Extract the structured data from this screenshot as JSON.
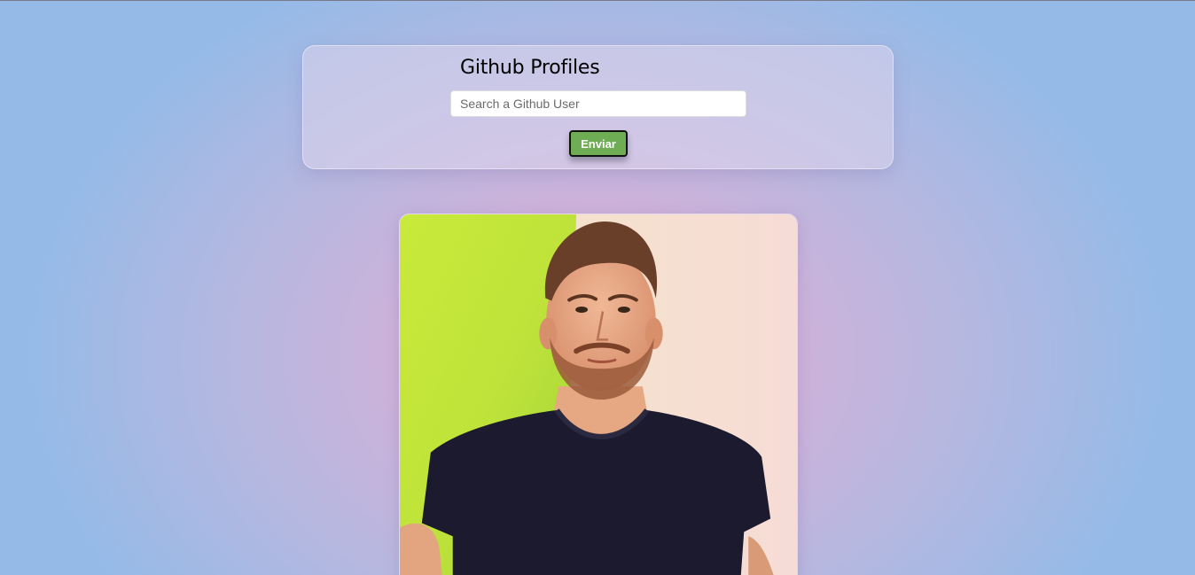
{
  "header": {
    "title": "Github Profiles"
  },
  "search": {
    "placeholder": "Search a Github User",
    "value": "",
    "submit_label": "Enviar"
  },
  "profile": {
    "avatar_alt": ""
  },
  "colors": {
    "button_bg": "#6fad55",
    "background_center": "#d4b2d8",
    "background_edge": "#95bae8"
  }
}
